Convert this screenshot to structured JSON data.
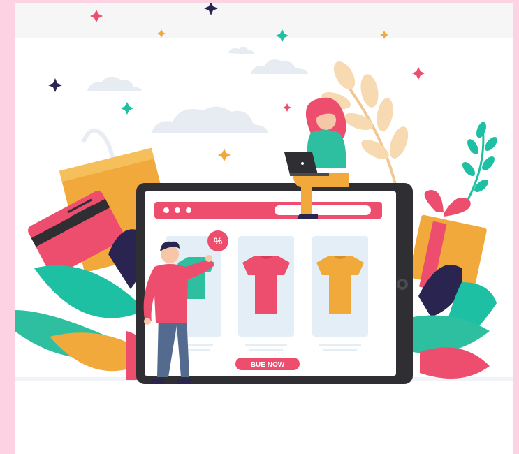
{
  "illustration": {
    "buy_button_label": "BUE NOW",
    "discount_badge_label": "%",
    "colors": {
      "page_border": "#fdd3e4",
      "accent_pink": "#ee4e6d",
      "teal": "#1ec0a4",
      "orange": "#f0a93a",
      "tablet_frame": "#2e2e33",
      "card_bg": "#e3eef7",
      "navy": "#2a2550"
    },
    "shirt_colors": [
      "#2dbfa0",
      "#ee4e6d",
      "#f0a93a"
    ]
  }
}
